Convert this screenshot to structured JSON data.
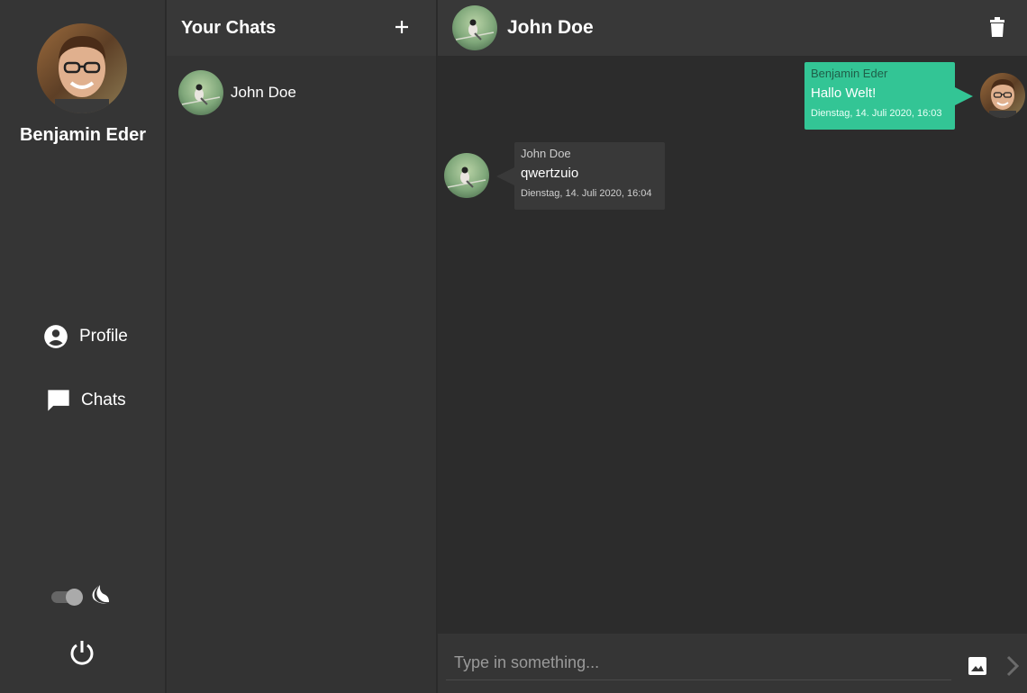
{
  "user": {
    "name": "Benjamin Eder"
  },
  "nav": {
    "items": [
      {
        "label": "Profile",
        "icon": "account-circle-icon"
      },
      {
        "label": "Chats",
        "icon": "chat-bubble-icon"
      }
    ],
    "dark_mode": true
  },
  "chat_list": {
    "title": "Your Chats",
    "chats": [
      {
        "name": "John Doe"
      }
    ]
  },
  "conversation": {
    "partner": "John Doe",
    "messages": [
      {
        "sender": "Benjamin Eder",
        "text": "Hallo Welt!",
        "time": "Dienstag, 14. Juli 2020, 16:03",
        "own": true
      },
      {
        "sender": "John Doe",
        "text": "qwertzuio",
        "time": "Dienstag, 14. Juli 2020, 16:04",
        "own": false
      }
    ],
    "composer": {
      "placeholder": "Type in something..."
    }
  },
  "colors": {
    "accent": "#33c595",
    "background": "#2c2c2c",
    "panel": "#353535"
  }
}
